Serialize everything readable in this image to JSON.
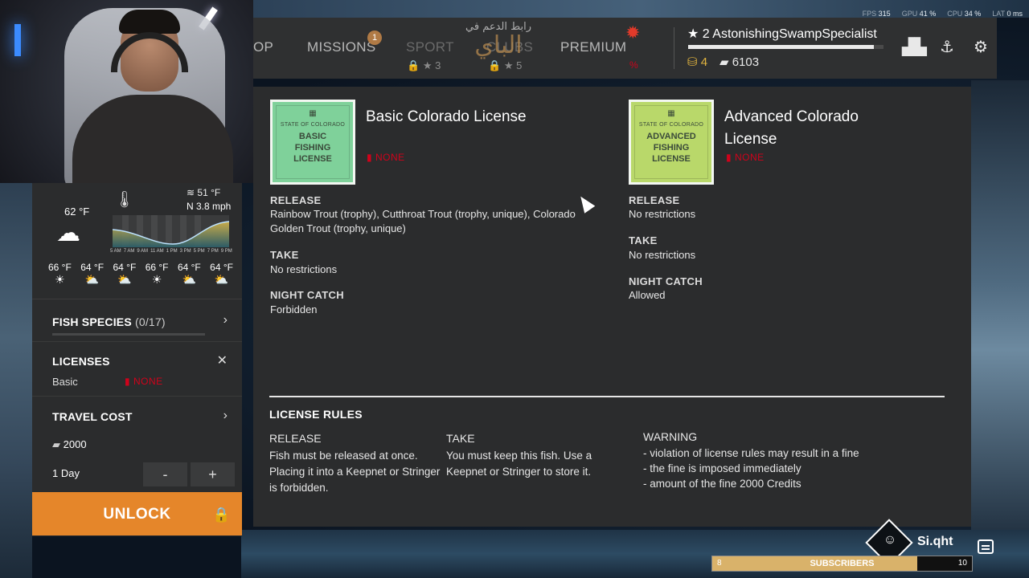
{
  "perf": {
    "fps_label": "FPS",
    "fps": "315",
    "gpu_label": "GPU",
    "gpu": "41 %",
    "cpu_label": "CPU",
    "cpu": "34 %",
    "lat_label": "LAT",
    "lat": "0 ms"
  },
  "nav": {
    "shop_partial": "OP",
    "missions": "MISSIONS",
    "missions_badge": "1",
    "sport": "SPORT",
    "sport_stars": "3",
    "clubs": "CLUBS",
    "clubs_stars": "5",
    "premium": "PREMIUM"
  },
  "logo": {
    "line1": "رابط الدعم في",
    "line2": "الباي"
  },
  "player": {
    "level": "2",
    "name": "AstonishingSwampSpecialist",
    "xp_fraction": 0.95,
    "gold": "4",
    "credits": "6103"
  },
  "weather": {
    "current_temp": "62 °F",
    "water_temp": "51 °F",
    "wind": "N 3.8 mph",
    "timeline": [
      "5 AM",
      "7 AM",
      "9 AM",
      "11 AM",
      "1 PM",
      "3 PM",
      "5 PM",
      "7 PM",
      "9 PM"
    ],
    "forecast": [
      "66 °F",
      "64 °F",
      "64 °F",
      "66 °F",
      "64 °F",
      "64 °F"
    ]
  },
  "sidebar": {
    "fish_species_label": "FISH SPECIES",
    "fish_species_count": "(0/17)",
    "licenses_label": "LICENSES",
    "license_value": "Basic",
    "license_none": "NONE",
    "travel_cost_label": "TRAVEL COST",
    "travel_cost_value": "2000",
    "days": "1 Day",
    "minus": "-",
    "plus": "+",
    "unlock": "UNLOCK"
  },
  "licenses": [
    {
      "card_state": "STATE OF COLORADO",
      "card_name_1": "BASIC",
      "card_name_2": "FISHING",
      "card_name_3": "LICENSE",
      "title": "Basic Colorado License",
      "status": "NONE",
      "release_h": "RELEASE",
      "release_1": "Rainbow Trout (trophy), Cutthroat Trout (trophy, unique), Colorado",
      "release_2": "Golden Trout (trophy, unique)",
      "take_h": "TAKE",
      "take": "No restrictions",
      "night_h": "NIGHT CATCH",
      "night": "Forbidden",
      "color": "#7fd19a"
    },
    {
      "card_state": "STATE OF COLORADO",
      "card_name_1": "ADVANCED",
      "card_name_2": "FISHING",
      "card_name_3": "LICENSE",
      "title_1": "Advanced Colorado",
      "title_2": "License",
      "status": "NONE",
      "release_h": "RELEASE",
      "release": "No restrictions",
      "take_h": "TAKE",
      "take": "No restrictions",
      "night_h": "NIGHT CATCH",
      "night": "Allowed",
      "color": "#b9d86a"
    }
  ],
  "rules": {
    "title": "LICENSE RULES",
    "release_h": "RELEASE",
    "release_1": "Fish must be released at once.",
    "release_2": "Placing it into a Keepnet or Stringer",
    "release_3": "is forbidden.",
    "take_h": "TAKE",
    "take_1": "You must keep this fish. Use a",
    "take_2": "Keepnet or Stringer to store it.",
    "warning_h": "WARNING",
    "warning_1": "- violation of license rules may result in a fine",
    "warning_2": "- the fine is imposed immediately",
    "warning_3": "- amount of the fine 2000 Credits"
  },
  "stream": {
    "handle": "Si.qht",
    "subs_label": "SUBSCRIBERS",
    "subs_min": "8",
    "subs_max": "10",
    "subs_progress": 0.79
  },
  "colors": {
    "accent": "#e5862a",
    "danger": "#d0021b",
    "panel": "#2b2c2d"
  }
}
